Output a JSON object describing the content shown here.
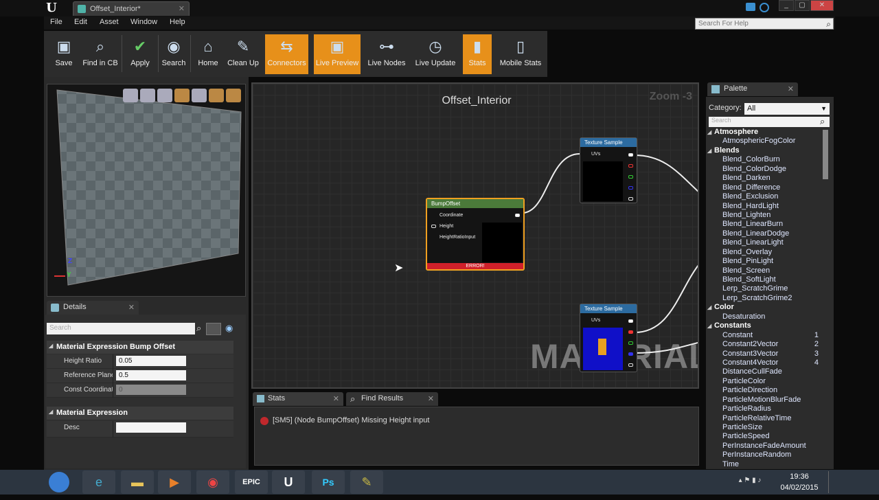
{
  "window": {
    "doc_tab": "Offset_Interior*",
    "min": "_",
    "max": "▢",
    "close": "✕"
  },
  "menu": [
    "File",
    "Edit",
    "Asset",
    "Window",
    "Help"
  ],
  "help_search": {
    "placeholder": "Search For Help"
  },
  "toolbar": [
    {
      "label": "Save",
      "icon": "floppy-icon",
      "active": false
    },
    {
      "label": "Find in CB",
      "icon": "magnifier-icon",
      "active": false
    },
    {
      "label": "Apply",
      "icon": "checkmark-icon",
      "active": false
    },
    {
      "label": "Search",
      "icon": "binoculars-icon",
      "active": false
    },
    {
      "label": "Home",
      "icon": "home-icon",
      "active": false
    },
    {
      "label": "Clean Up",
      "icon": "broom-icon",
      "active": false
    },
    {
      "label": "Connectors",
      "icon": "connectors-icon",
      "active": true
    },
    {
      "label": "Live Preview",
      "icon": "tv-icon",
      "active": true
    },
    {
      "label": "Live Nodes",
      "icon": "nodes-icon",
      "active": false
    },
    {
      "label": "Live Update",
      "icon": "clock-icon",
      "active": false
    },
    {
      "label": "Stats",
      "icon": "bar-chart-icon",
      "active": true
    },
    {
      "label": "Mobile Stats",
      "icon": "mobile-icon",
      "active": false
    }
  ],
  "viewport": {
    "axis_z": "Z",
    "axis_y": "Y"
  },
  "details": {
    "tab": "Details",
    "search_placeholder": "Search",
    "sections": {
      "bump": "Material Expression Bump Offset",
      "expr": "Material Expression"
    },
    "props": [
      {
        "key": "Height Ratio",
        "value": "0.05"
      },
      {
        "key": "Reference Plane",
        "value": "0.5"
      },
      {
        "key": "Const Coordinate",
        "value": "0"
      }
    ],
    "desc_key": "Desc",
    "desc_value": ""
  },
  "graph": {
    "title": "Offset_Interior",
    "zoom": "Zoom -3",
    "watermark": "MATERIAL",
    "bump_node": {
      "title": "BumpOffset",
      "pins": [
        "Coordinate",
        "Height",
        "HeightRatioInput"
      ],
      "error": "ERROR!"
    },
    "tex1": {
      "title": "Texture Sample",
      "pin": "UVs"
    },
    "tex2": {
      "title": "Texture Sample",
      "pin": "UVs"
    }
  },
  "panels": {
    "stats_tab": "Stats",
    "find_tab": "Find Results",
    "error_message": "[SM5] (Node BumpOffset) Missing Height input"
  },
  "palette": {
    "tab": "Palette",
    "category_label": "Category:",
    "category_value": "All",
    "search_placeholder": "Search",
    "items": [
      {
        "label": "Atmosphere",
        "cat": true
      },
      {
        "label": "AtmosphericFogColor"
      },
      {
        "label": "Blends",
        "cat": true
      },
      {
        "label": "Blend_ColorBurn"
      },
      {
        "label": "Blend_ColorDodge"
      },
      {
        "label": "Blend_Darken"
      },
      {
        "label": "Blend_Difference"
      },
      {
        "label": "Blend_Exclusion"
      },
      {
        "label": "Blend_HardLight"
      },
      {
        "label": "Blend_Lighten"
      },
      {
        "label": "Blend_LinearBurn"
      },
      {
        "label": "Blend_LinearDodge"
      },
      {
        "label": "Blend_LinearLight"
      },
      {
        "label": "Blend_Overlay"
      },
      {
        "label": "Blend_PinLight"
      },
      {
        "label": "Blend_Screen"
      },
      {
        "label": "Blend_SoftLight"
      },
      {
        "label": "Lerp_ScratchGrime"
      },
      {
        "label": "Lerp_ScratchGrime2"
      },
      {
        "label": "Color",
        "cat": true
      },
      {
        "label": "Desaturation"
      },
      {
        "label": "Constants",
        "cat": true
      },
      {
        "label": "Constant",
        "num": "1"
      },
      {
        "label": "Constant2Vector",
        "num": "2"
      },
      {
        "label": "Constant3Vector",
        "num": "3"
      },
      {
        "label": "Constant4Vector",
        "num": "4"
      },
      {
        "label": "DistanceCullFade"
      },
      {
        "label": "ParticleColor"
      },
      {
        "label": "ParticleDirection"
      },
      {
        "label": "ParticleMotionBlurFade"
      },
      {
        "label": "ParticleRadius"
      },
      {
        "label": "ParticleRelativeTime"
      },
      {
        "label": "ParticleSize"
      },
      {
        "label": "ParticleSpeed"
      },
      {
        "label": "PerInstanceFadeAmount"
      },
      {
        "label": "PerInstanceRandom"
      },
      {
        "label": "Time"
      }
    ]
  },
  "taskbar": {
    "apps": [
      "start-orb-icon",
      "internet-explorer-icon",
      "file-explorer-icon",
      "media-player-icon",
      "chrome-icon",
      "epic-games-icon",
      "unreal-engine-icon",
      "photoshop-icon",
      "tool-icon"
    ],
    "epic_label": "EPIC",
    "ps_label": "Ps",
    "time": "19:36",
    "date": "04/02/2015"
  },
  "colors": {
    "accent_orange": "#e7901a",
    "node_header_blue": "#2c6ba0",
    "error_red": "#c0282c"
  }
}
